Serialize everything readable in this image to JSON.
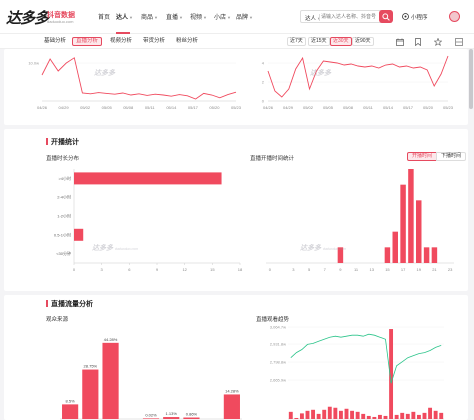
{
  "header": {
    "logo_main": "达多多",
    "logo_sub": "抖音数据",
    "logo_url": "daduoduo.com",
    "nav": [
      {
        "label": "首页",
        "caret": false
      },
      {
        "label": "达人",
        "caret": true,
        "active": true
      },
      {
        "label": "商品",
        "caret": true
      },
      {
        "label": "直播",
        "caret": true
      },
      {
        "label": "视频",
        "caret": true
      },
      {
        "label": "小店",
        "caret": true
      },
      {
        "label": "品牌",
        "caret": true
      }
    ],
    "search_type": "达人",
    "search_placeholder": "请输入达人名称、抖音号",
    "mini_program": "小程序"
  },
  "tabs": [
    "基础分析",
    "直播分析",
    "视频分析",
    "带货分析",
    "粉丝分析"
  ],
  "active_tab": "直播分析",
  "ranges": [
    "近7天",
    "近15天",
    "近30天",
    "近90天"
  ],
  "active_range": "近30天",
  "watermark": {
    "text": "达多多",
    "sub": "daduoduo.com"
  },
  "colors": {
    "accent": "#e64a5f",
    "bar": "#f04a5e",
    "line": "#2bc48a"
  },
  "top_charts": {
    "left": {
      "ytick": "10.0w",
      "x": [
        "04/26",
        "04/29",
        "05/02",
        "05/05",
        "05/08",
        "05/11",
        "05/14",
        "05/17",
        "05/20",
        "05/23"
      ],
      "values": [
        6.5,
        10.5,
        7.5,
        9.5,
        10.8,
        2,
        1.8,
        2.1,
        1.9,
        1.7,
        2.0,
        1.5,
        1.8,
        1.4,
        1.7,
        1.5,
        1.2,
        1.6,
        1.3,
        0.5,
        1.9,
        1.5,
        0.8,
        1.6,
        2.2
      ],
      "ylim": [
        0,
        12
      ]
    },
    "right": {
      "yticks": [
        "4",
        "2",
        "0"
      ],
      "x": [
        "04/26",
        "04/29",
        "05/02",
        "05/05",
        "05/08",
        "05/11",
        "05/14",
        "05/17",
        "05/20",
        "05/23"
      ],
      "values": [
        3,
        1,
        0.4,
        1.2,
        3.2,
        4.3,
        1.2,
        3,
        4,
        3.9,
        3.8,
        3.6,
        3.7,
        3.5,
        3.4,
        3.5,
        3.3,
        3.6,
        3.7,
        3.4,
        3.5,
        3.3,
        3.4,
        3.1,
        1.5,
        2.7,
        4.5
      ],
      "ylim": [
        0,
        5
      ]
    }
  },
  "broadcast": {
    "title": "开播统计",
    "duration": {
      "title": "直播时长分布",
      "categories": [
        ">4小时",
        "2-4小时",
        "1-2小时",
        "0.5-1小时",
        "<30分钟"
      ],
      "values": [
        16,
        0,
        0,
        1,
        0
      ],
      "xticks": [
        "0",
        "3",
        "6",
        "9",
        "12",
        "15",
        "18"
      ],
      "xlim": [
        0,
        18
      ]
    },
    "time": {
      "title": "直播开播时间统计",
      "toggles": [
        "开播时间",
        "下播时间"
      ],
      "active_toggle": "开播时间",
      "hours": [
        0,
        1,
        2,
        3,
        4,
        5,
        6,
        7,
        8,
        9,
        10,
        11,
        12,
        13,
        14,
        15,
        16,
        17,
        18,
        19,
        20,
        21,
        22,
        23
      ],
      "values": [
        0,
        0,
        0,
        0,
        0,
        0,
        0,
        0,
        0,
        1,
        0,
        0,
        0,
        0,
        0,
        1,
        2,
        5,
        6,
        4,
        1,
        1,
        0,
        0
      ],
      "xticks": [
        "0",
        "3",
        "5",
        "7",
        "9",
        "11",
        "13",
        "15",
        "17",
        "19",
        "21",
        "23"
      ],
      "xtick_hours": [
        0,
        3,
        5,
        7,
        9,
        11,
        13,
        15,
        17,
        19,
        21,
        23
      ],
      "ylim": [
        0,
        6
      ]
    }
  },
  "traffic": {
    "title": "直播流量分析",
    "source": {
      "title": "观众来源",
      "labels": [
        "8.5%",
        "28.75%",
        "44.28%",
        "",
        "0.02%",
        "1.13%",
        "0.86%",
        "",
        "14.28%"
      ],
      "values": [
        8.5,
        28.75,
        44.28,
        0,
        0.02,
        1.13,
        0.86,
        0,
        14.28
      ],
      "ylim": [
        0,
        50
      ]
    },
    "trend": {
      "title": "直播观看趋势",
      "yticks": [
        "3,064.7w",
        "2,931.8w",
        "2,798.8w",
        "2,665.9w"
      ],
      "bars": [
        0.7,
        0.1,
        0.55,
        0.8,
        0.9,
        0.5,
        0.9,
        1.2,
        1.1,
        0.8,
        1.0,
        0.8,
        0.7,
        0.5,
        0.3,
        0.2,
        0.4,
        0.3,
        8.8,
        0.4,
        0.6,
        0.5,
        0.7,
        0.4,
        0.6,
        1.1,
        0.8,
        0.6
      ],
      "line": [
        6,
        6.5,
        6.8,
        7.3,
        7.4,
        7.6,
        7.8,
        8.0,
        8.1,
        8.0,
        8.1,
        8.2,
        8.2,
        8.1,
        8.3,
        8.2,
        8.0,
        7.8,
        3.5,
        5.2,
        5.6,
        6.0,
        6.2,
        6.4,
        6.5,
        6.7,
        7.0,
        7.2
      ],
      "ylim": [
        0,
        9
      ]
    }
  }
}
